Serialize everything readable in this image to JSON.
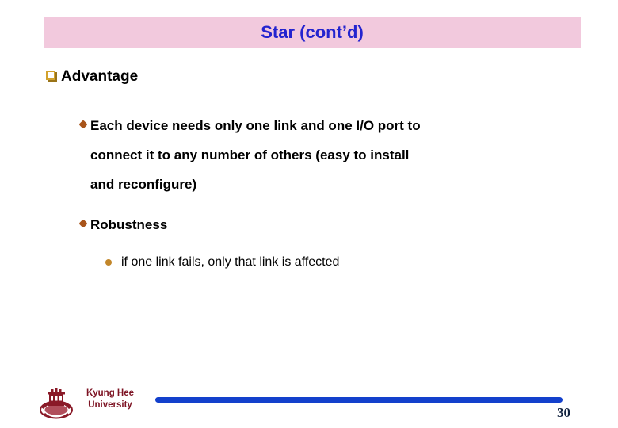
{
  "slide": {
    "title": "Star (cont’d)",
    "title_color": "#2424cf",
    "banner_color": "#f2c9dd",
    "page_number": "30"
  },
  "content": {
    "heading": {
      "bullet": "hollow-square-bullet-icon",
      "label": "Advantage"
    },
    "points": [
      {
        "bullet": "diamond-bullet-icon",
        "lines": [
          "Each device needs only one link and one I/O port to",
          "connect it to any number of others (easy to install",
          "and reconfigure)"
        ],
        "text": "Each device needs only one link and one I/O port to connect it to any number of others (easy to install and reconfigure)"
      },
      {
        "bullet": "diamond-bullet-icon",
        "lines": [
          "Robustness"
        ],
        "text": "Robustness"
      }
    ],
    "subpoints": [
      {
        "bullet": "round-bullet-icon",
        "text": "if one link fails, only that link is affected"
      }
    ]
  },
  "footer": {
    "logo": "kyung-hee-crest-icon",
    "university_line1": "Kyung Hee",
    "university_line2": "University",
    "university_color": "#7d1323",
    "bar_color": "#1340cc"
  }
}
